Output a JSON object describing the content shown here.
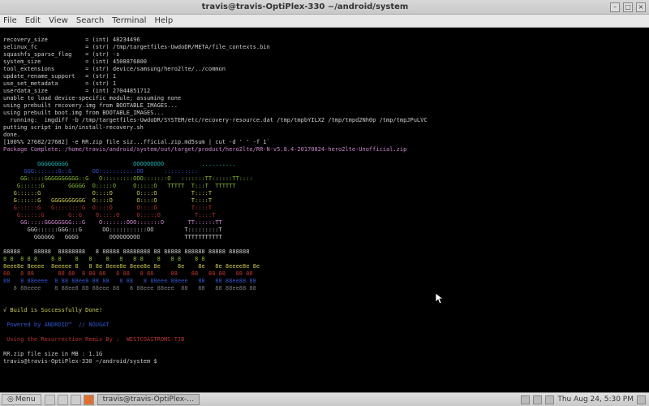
{
  "window": {
    "title": "travis@travis-OptiPlex-330 ~/android/system"
  },
  "menus": {
    "file": "File",
    "edit": "Edit",
    "view": "View",
    "search": "Search",
    "terminal": "Terminal",
    "help": "Help"
  },
  "out": {
    "l1": "recovery_size           = (int) 48234496",
    "l2": "selinux_fc              = (str) /tmp/targetfiles-UwdoDR/META/file_contexts.bin",
    "l3": "squashfs_sparse_flag    = (str) -s",
    "l4": "system_size             = (int) 4508876800",
    "l5": "tool_extensions         = (str) device/samsung/hero2lte/../common",
    "l6": "update_rename_support   = (str) 1",
    "l7": "use_set_metadata        = (str) 1",
    "l8": "userdata_size           = (int) 27044851712",
    "l9": "unable to load device-specific module; assuming none",
    "l10": "using prebuilt recovery.img from BOOTABLE_IMAGES...",
    "l11": "using prebuilt boot.img from BOOTABLE_IMAGES...",
    "l12": "  running:  imgdiff -b /tmp/targetfiles-UwdoDR/SYSTEM/etc/recovery-resource.dat /tmp/tmpbYILX2 /tmp/tmpd2Nh0p /tmp/tmpJPuLVC",
    "l13": "putting script in bin/install-recovery.sh",
    "l14": "done.",
    "l15": "[100%% 27682/27682] -e RR.zip file siz...fficial.zip.md5sum | cut -d ' ' -f 1`",
    "l16": "Package Complete: /home/travis/android/system/out/target/product/hero2lte/RR-N-v5.8.4-20170824-hero2lte-Unofficial.zip",
    "a1": "          GGGGGGGGG                   OOOOOOOOO           ..........         ",
    "a2": "      GGG:::::::G::G      OO:::::::::::OO      ::::::::::       ",
    "a3": "     GG:::::GGGGGGGGGG::G   O:::::::::OOO:::::::O   :::::::TT::::::TT::::   ",
    "a4": "    G::::::G       GGGGG  O:::::O     O:::::O   TTTTT  T:::T  TTTTTT   ",
    "a5": "   G::::::G               O::::O       O::::O          T::::T           ",
    "a6": "   G::::::G   GGGGGGGGGG  O::::O       O::::O          T::::T           ",
    "a7": "   G::::::G   G::::::::G  O::::O       O::::O          T::::T           ",
    "a8": "    G::::::G       G::G    O:::::O     O:::::O          T::::T           ",
    "a9": "     GG:::::GGGGGGGG:::G    O:::::::OOO:::::::O       TT::::::TT         ",
    "a10": "       GGG::::::GGG:::G      OO:::::::::::OO         T:::::::::T         ",
    "a11": "         GGGGGG   GGGG         OOOOOOOOO             TTTTTTTTTTT         ",
    "b1": "88888    88888  88888888   8 88888 88888888 88 88888 888888 88888 888888",
    "b2": "8 8  8 8 8    8 8    8   8    8   8   8 8    8   8 8    8 8 ",
    "b3": "8eee8e 8eeee  8eeeee 8   8 8e 8eee8e 8eee8e 8e     8e    8e   8e 8eeee8e 8e",
    "b4": "88   8 88       88 88  8 88 88   8 88   8 88     88    88   88 88   88 88",
    "b5": "88   8 88eeee  8 88 88ee8 88 88   8 88   8 88eee 88eee   88   88 88ee88 88",
    "b6": "   8 88eeee    8 88ee8 88 88eee 88   8 88eee 88eee  88   88   88 88ee88 88",
    "done": "√ Build is Successfully Done!",
    "pow": " Powered by ANDROID™  // NOUGAT",
    "redline": " Using the Resurrection Remix By :  WESTCOASTROMS-TJB",
    "size": "RR.zip file size in MB : 1.1G",
    "prompt": "travis@travis-OptiPlex-330 ~/android/system $"
  },
  "taskbar": {
    "menu": "Menu",
    "task": "travis@travis-OptiPlex-...",
    "clock": "Thu Aug 24, 5:30 PM"
  }
}
